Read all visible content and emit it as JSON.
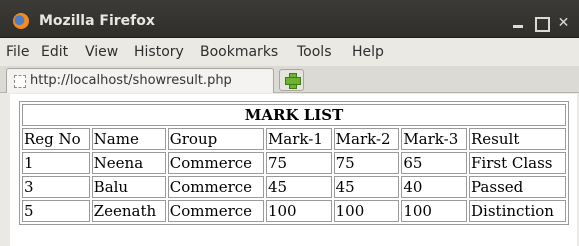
{
  "window": {
    "title": "Mozilla Firefox",
    "icon": "firefox-icon"
  },
  "menubar": {
    "items": [
      "File",
      "Edit",
      "View",
      "History",
      "Bookmarks",
      "Tools",
      "Help"
    ]
  },
  "tabs": {
    "active_label": "http://localhost/showresult.php"
  },
  "table": {
    "title": "MARK LIST",
    "headers": [
      "Reg No",
      "Name",
      "Group",
      "Mark-1",
      "Mark-2",
      "Mark-3",
      "Result"
    ],
    "rows": [
      [
        "1",
        "Neena",
        "Commerce",
        "75",
        "75",
        "65",
        "First Class"
      ],
      [
        "3",
        "Balu",
        "Commerce",
        "45",
        "45",
        "40",
        "Passed"
      ],
      [
        "5",
        "Zeenath",
        "Commerce",
        "100",
        "100",
        "100",
        "Distinction"
      ]
    ]
  },
  "colors": {
    "titlebar": "#3c3b37",
    "chrome": "#ebe9e4",
    "table_border": "#9a9a9a"
  }
}
